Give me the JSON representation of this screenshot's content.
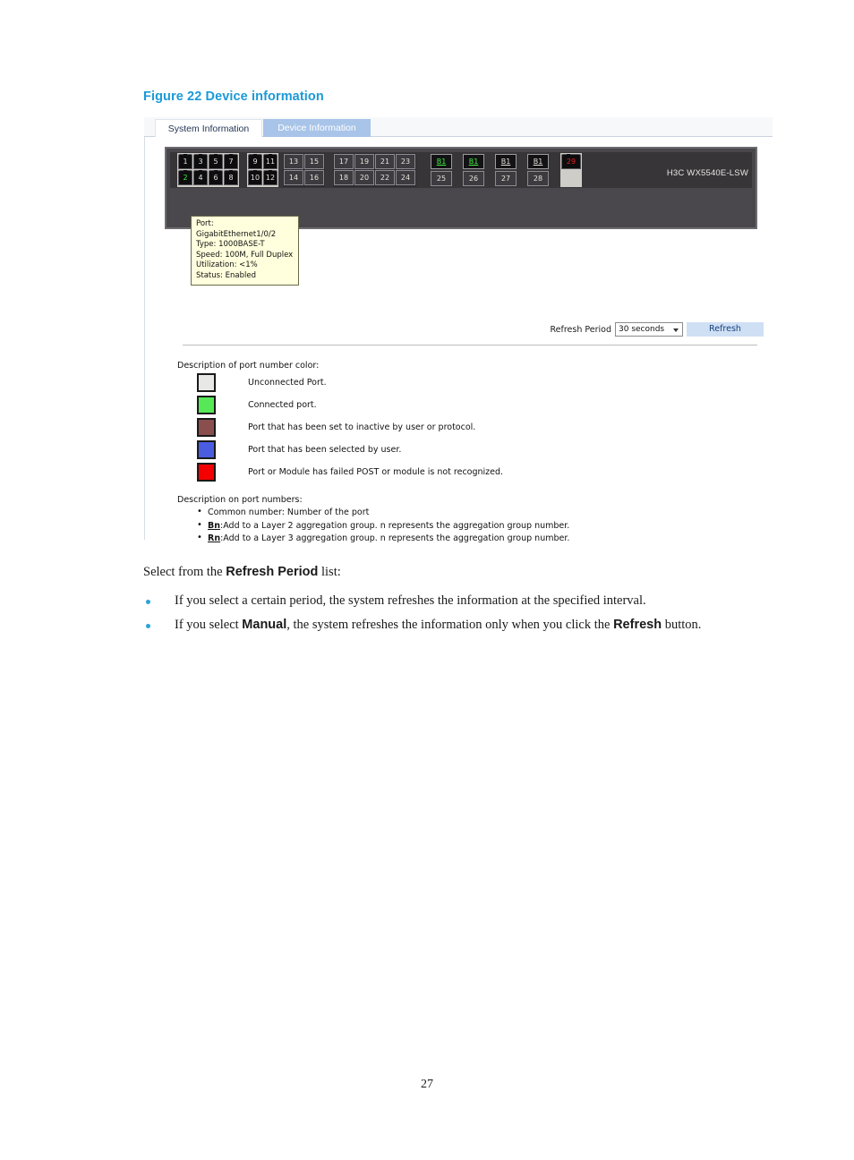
{
  "figure": {
    "caption": "Figure 22 Device information"
  },
  "screenshot": {
    "tabs": [
      {
        "label": "System Information",
        "active": false
      },
      {
        "label": "Device Information",
        "active": true
      }
    ],
    "device": {
      "model_label": "H3C WX5540E-LSW",
      "port_groups": [
        {
          "style": "rj45",
          "top": [
            "1",
            "3",
            "5",
            "7"
          ],
          "bottom": [
            "2",
            "4",
            "6",
            "8"
          ],
          "top_colors": [
            "white",
            "white",
            "white",
            "white"
          ],
          "bottom_colors": [
            "green",
            "white",
            "white",
            "white"
          ]
        },
        {
          "style": "rj45",
          "top": [
            "9",
            "11"
          ],
          "bottom": [
            "10",
            "12"
          ],
          "top_colors": [
            "white",
            "white"
          ],
          "bottom_colors": [
            "white",
            "white"
          ]
        },
        {
          "style": "flat",
          "top": [
            "13",
            "15"
          ],
          "bottom": [
            "14",
            "16"
          ],
          "top_colors": [
            "white",
            "white"
          ],
          "bottom_colors": [
            "white",
            "white"
          ]
        },
        {
          "style": "flat",
          "top": [
            "17",
            "19",
            "21",
            "23"
          ],
          "bottom": [
            "18",
            "20",
            "22",
            "24"
          ],
          "top_colors": [
            "white",
            "white",
            "white",
            "white"
          ],
          "bottom_colors": [
            "white",
            "white",
            "white",
            "white"
          ]
        }
      ],
      "aggregation_ports": [
        {
          "label": "B1",
          "color": "green"
        },
        {
          "label": "B1",
          "color": "green"
        },
        {
          "label": "B1",
          "color": "white"
        },
        {
          "label": "B1",
          "color": "white"
        }
      ],
      "aggregation_bottom": [
        "25",
        "26",
        "27",
        "28"
      ],
      "last_port": {
        "label": "29",
        "color": "red"
      }
    },
    "tooltip": {
      "lines": [
        "Port: GigabitEthernet1/0/2",
        "Type: 1000BASE-T",
        "Speed: 100M, Full Duplex",
        "Utilization: <1%",
        "Status: Enabled"
      ]
    },
    "refresh": {
      "label": "Refresh Period",
      "selected_value": "30 seconds",
      "button_label": "Refresh"
    },
    "legend": {
      "title": "Description of port number color:",
      "items": [
        {
          "color": "#e8e8e6",
          "text": "Unconnected Port."
        },
        {
          "color": "#56e856",
          "text": "Connected port."
        },
        {
          "color": "#8a4e4e",
          "text": "Port that has been set to inactive by user or protocol."
        },
        {
          "color": "#4a5ce0",
          "text": "Port that has been selected by user."
        },
        {
          "color": "#f40000",
          "text": "Port or Module has failed POST or module is not recognized."
        }
      ]
    },
    "port_numbers": {
      "title": "Description on port numbers:",
      "items": [
        {
          "prefix": "",
          "text": "Common number: Number of the port"
        },
        {
          "prefix": "Bn",
          "text": ":Add to a Layer 2 aggregation group. n represents the aggregation group number."
        },
        {
          "prefix": "Rn",
          "text": ":Add to a Layer 3 aggregation group. n represents the aggregation group number."
        }
      ]
    }
  },
  "body": {
    "intro_pre": "Select from the ",
    "intro_bold": "Refresh Period",
    "intro_post": " list:",
    "bullets": [
      {
        "pre": "If you select a certain period, the system refreshes the information at the specified interval.",
        "bold": "",
        "post": ""
      },
      {
        "pre": "If you select ",
        "bold": "Manual",
        "post": ", the system refreshes the information only when you click the ",
        "bold2": "Refresh",
        "post2": " button."
      }
    ]
  },
  "footer": {
    "page_number": "27"
  }
}
